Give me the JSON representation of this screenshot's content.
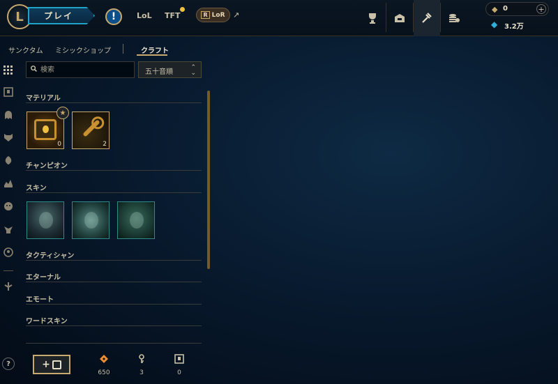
{
  "topbar": {
    "logo": "L",
    "play_label": "プレイ",
    "alert_icon": "!",
    "lol_label": "LoL",
    "tft_label": "TFT",
    "lor_label": "LoR",
    "lor_prefix": "R",
    "external_icon": "↗",
    "nav_icons": [
      "trophy-icon",
      "collection-icon",
      "loot-icon",
      "store-icon"
    ],
    "rp_value": "0",
    "be_value": "3.2万"
  },
  "subnav": {
    "items": [
      "サンクタム",
      "ミシックショップ",
      "クラフト"
    ],
    "active": "クラフト"
  },
  "search": {
    "placeholder": "検索",
    "value": ""
  },
  "sort": {
    "value": "五十音順"
  },
  "sections": {
    "materials": "マテリアル",
    "champions": "チャンピオン",
    "skins": "スキン",
    "tacticians": "タクティシャン",
    "eternals": "エターナル",
    "emotes": "エモート",
    "ward_skins": "ワードスキン"
  },
  "materials": [
    {
      "name": "chest",
      "count": "0"
    },
    {
      "name": "key",
      "count": "2"
    }
  ],
  "skins_count": 3,
  "footer": {
    "forge_label": "+",
    "orange_essence": "650",
    "keys": "3",
    "chests": "0"
  },
  "help_label": "?",
  "colors": {
    "gold": "#c8aa6e",
    "play_border": "#1fa3c7",
    "orange_essence": "#f08c30",
    "blue_essence": "#2fb0d8"
  }
}
